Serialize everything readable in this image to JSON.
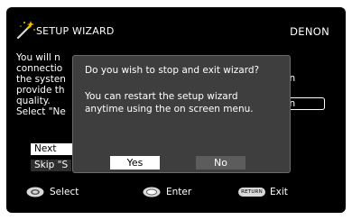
{
  "header": {
    "title": "SETUP WIZARD",
    "brand": "DENON",
    "icon": "magic-wand-icon"
  },
  "background_text": {
    "lines": [
      "You will n",
      "connectio",
      "the systen",
      "provide th",
      "quality.",
      "Select \"Ne"
    ],
    "right_fragment_1": "tion",
    "right_fragment_2": "tion"
  },
  "options": {
    "next": "Next",
    "skip": "Skip \"S"
  },
  "dialog": {
    "question": "Do you wish to stop and exit wizard?",
    "message_line_1": "You can restart the setup wizard",
    "message_line_2": "anytime using the on screen menu.",
    "yes_label": "Yes",
    "no_label": "No"
  },
  "footer": {
    "select_label": "Select",
    "enter_label": "Enter",
    "return_key": "RETURN",
    "exit_label": "Exit",
    "select_icon": "cursor-pad-icon",
    "enter_icon": "enter-button-icon"
  },
  "colors": {
    "screen_bg": "#000000",
    "dialog_bg": "#3e3e3e",
    "selected_button_bg": "#ffffff",
    "unselected_button_bg": "#5c5c5c"
  }
}
